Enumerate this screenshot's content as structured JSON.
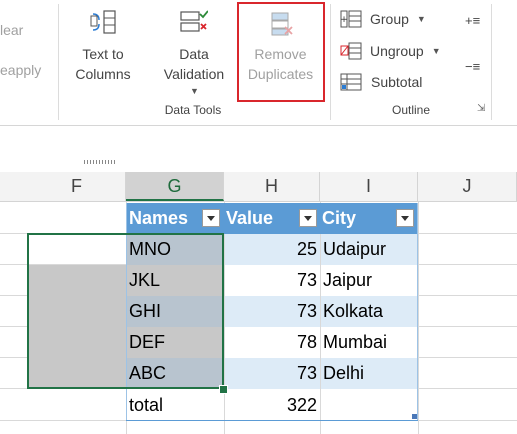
{
  "ribbon": {
    "clear_label": "lear",
    "reapply_label": "eapply",
    "text_to_columns_line1": "Text to",
    "text_to_columns_line2": "Columns",
    "data_validation_line1": "Data",
    "data_validation_line2": "Validation",
    "remove_duplicates_line1": "Remove",
    "remove_duplicates_line2": "Duplicates",
    "data_tools_group": "Data Tools",
    "group_label": "Group",
    "ungroup_label": "Ungroup",
    "subtotal_label": "Subtotal",
    "outline_group": "Outline"
  },
  "columns": [
    "F",
    "G",
    "H",
    "I",
    "J"
  ],
  "table": {
    "headers": [
      "Names",
      "Value",
      "City"
    ],
    "rows": [
      {
        "name": "MNO",
        "value": "25",
        "city": "Udaipur"
      },
      {
        "name": "JKL",
        "value": "73",
        "city": "Jaipur"
      },
      {
        "name": "GHI",
        "value": "73",
        "city": "Kolkata"
      },
      {
        "name": "DEF",
        "value": "78",
        "city": "Mumbai"
      },
      {
        "name": "ABC",
        "value": "73",
        "city": "Delhi"
      }
    ],
    "total_label": "total",
    "total_value": "322"
  },
  "colors": {
    "table_header": "#5b9bd5",
    "table_band": "#ddebf7",
    "selection_border": "#217346",
    "selection_fill": "#c8c8c8",
    "highlight_red": "#d9262c"
  }
}
